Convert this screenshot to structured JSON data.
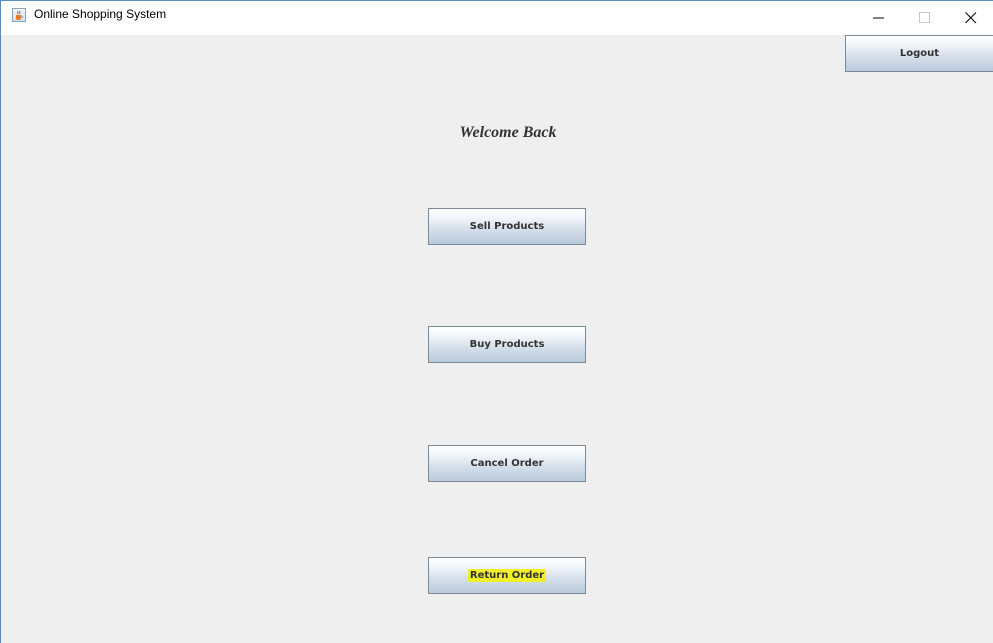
{
  "window": {
    "title": "Online Shopping System",
    "app_icon": "java-cup-icon",
    "controls": [
      "minimize-icon",
      "maximize-icon",
      "close-icon"
    ]
  },
  "header": {
    "logout_label": "Logout"
  },
  "main": {
    "welcome_text": "Welcome Back",
    "buttons": [
      {
        "label": "Sell Products"
      },
      {
        "label": "Buy Products"
      },
      {
        "label": "Cancel Order"
      },
      {
        "label": "Return Order",
        "highlighted": true
      }
    ]
  },
  "colors": {
    "background": "#efefef",
    "button_border": "#7a8a99",
    "highlight": "#f0f02a",
    "window_border": "#5b8bbd"
  }
}
